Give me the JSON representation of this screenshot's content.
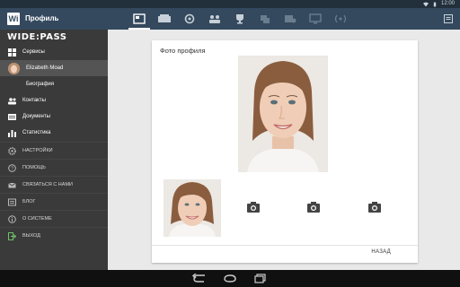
{
  "status_bar": {
    "time": "12:00"
  },
  "app_bar": {
    "logo_letters": "Wi",
    "title": "Профиль"
  },
  "tabs": [
    {
      "icon": "card-icon",
      "active": true
    },
    {
      "icon": "tickets-icon",
      "active": false
    },
    {
      "icon": "target-icon",
      "active": false
    },
    {
      "icon": "people-icon",
      "active": false
    },
    {
      "icon": "trophy-icon",
      "active": false
    },
    {
      "icon": "gallery-icon",
      "active": false
    },
    {
      "icon": "share-icon",
      "active": false
    },
    {
      "icon": "screen-icon",
      "active": false
    },
    {
      "icon": "broadcast-icon",
      "active": false
    }
  ],
  "sidebar": {
    "brand": "WIDE:PASS",
    "primary": [
      {
        "label": "Сервисы",
        "icon": "grid-icon"
      },
      {
        "label": "Elizabeth Moad",
        "icon": "avatar"
      },
      {
        "label": "Биография",
        "icon": ""
      },
      {
        "label": "Контакты",
        "icon": "contacts-icon"
      },
      {
        "label": "Документы",
        "icon": "documents-icon"
      },
      {
        "label": "Статистика",
        "icon": "stats-icon"
      }
    ],
    "secondary": [
      {
        "label": "НАСТРОЙКИ",
        "icon": "gear-icon"
      },
      {
        "label": "ПОМОЩЬ",
        "icon": "help-icon"
      },
      {
        "label": "СВЯЗАТЬСЯ С НАМИ",
        "icon": "mail-icon"
      },
      {
        "label": "БЛОГ",
        "icon": "blog-icon"
      },
      {
        "label": "О СИСТЕМЕ",
        "icon": "info-icon"
      },
      {
        "label": "ВЫХОД",
        "icon": "exit-icon"
      }
    ]
  },
  "profile_card": {
    "title": "Фото профиля",
    "back_label": "НАЗАД"
  },
  "colors": {
    "appbar": "#34495e",
    "sidebar": "#3a3a3a",
    "statusbar": "#22303c"
  }
}
